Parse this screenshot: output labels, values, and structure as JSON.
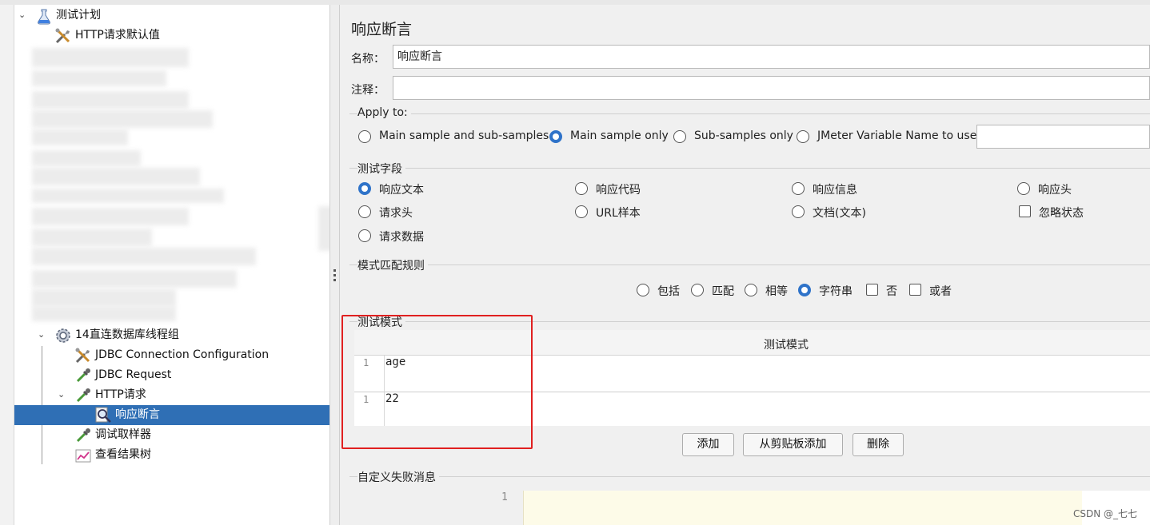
{
  "tree": {
    "root": "测试计划",
    "http_defaults": "HTTP请求默认值",
    "thread_group": "14直连数据库线程组",
    "jdbc_config": "JDBC Connection Configuration",
    "jdbc_request": "JDBC Request",
    "http_request": "HTTP请求",
    "assertion": "响应断言",
    "debug_sampler": "调试取样器",
    "result_tree": "查看结果树"
  },
  "panel": {
    "title": "响应断言",
    "name_label": "名称：",
    "name_value": "响应断言",
    "comment_label": "注释：",
    "comment_value": ""
  },
  "apply_to": {
    "title": "Apply to:",
    "options": [
      "Main sample and sub-samples",
      "Main sample only",
      "Sub-samples only",
      "JMeter Variable Name to use"
    ],
    "selected": "Main sample only",
    "variable_value": ""
  },
  "test_field": {
    "title": "测试字段",
    "options": [
      "响应文本",
      "响应代码",
      "响应信息",
      "响应头",
      "请求头",
      "URL样本",
      "文档(文本)",
      "请求数据"
    ],
    "checkbox_label": "忽略状态",
    "selected": "响应文本"
  },
  "pattern_rule": {
    "title": "模式匹配规则",
    "radios": [
      "包括",
      "匹配",
      "相等",
      "字符串"
    ],
    "checkboxes": [
      "否",
      "或者"
    ],
    "selected": "字符串"
  },
  "patterns": {
    "title": "测试模式",
    "column": "测试模式",
    "rows": [
      {
        "num": "1",
        "value": "age"
      },
      {
        "num": "1",
        "value": "22"
      }
    ],
    "buttons": {
      "add": "添加",
      "add_clipboard": "从剪贴板添加",
      "delete": "删除"
    }
  },
  "failure_message": {
    "title": "自定义失败消息",
    "line_number": "1"
  },
  "watermark": "CSDN @_七七",
  "colors": {
    "selection": "#2f6fb5",
    "radio_on": "#2f73c9",
    "highlight_box": "#e02020"
  }
}
